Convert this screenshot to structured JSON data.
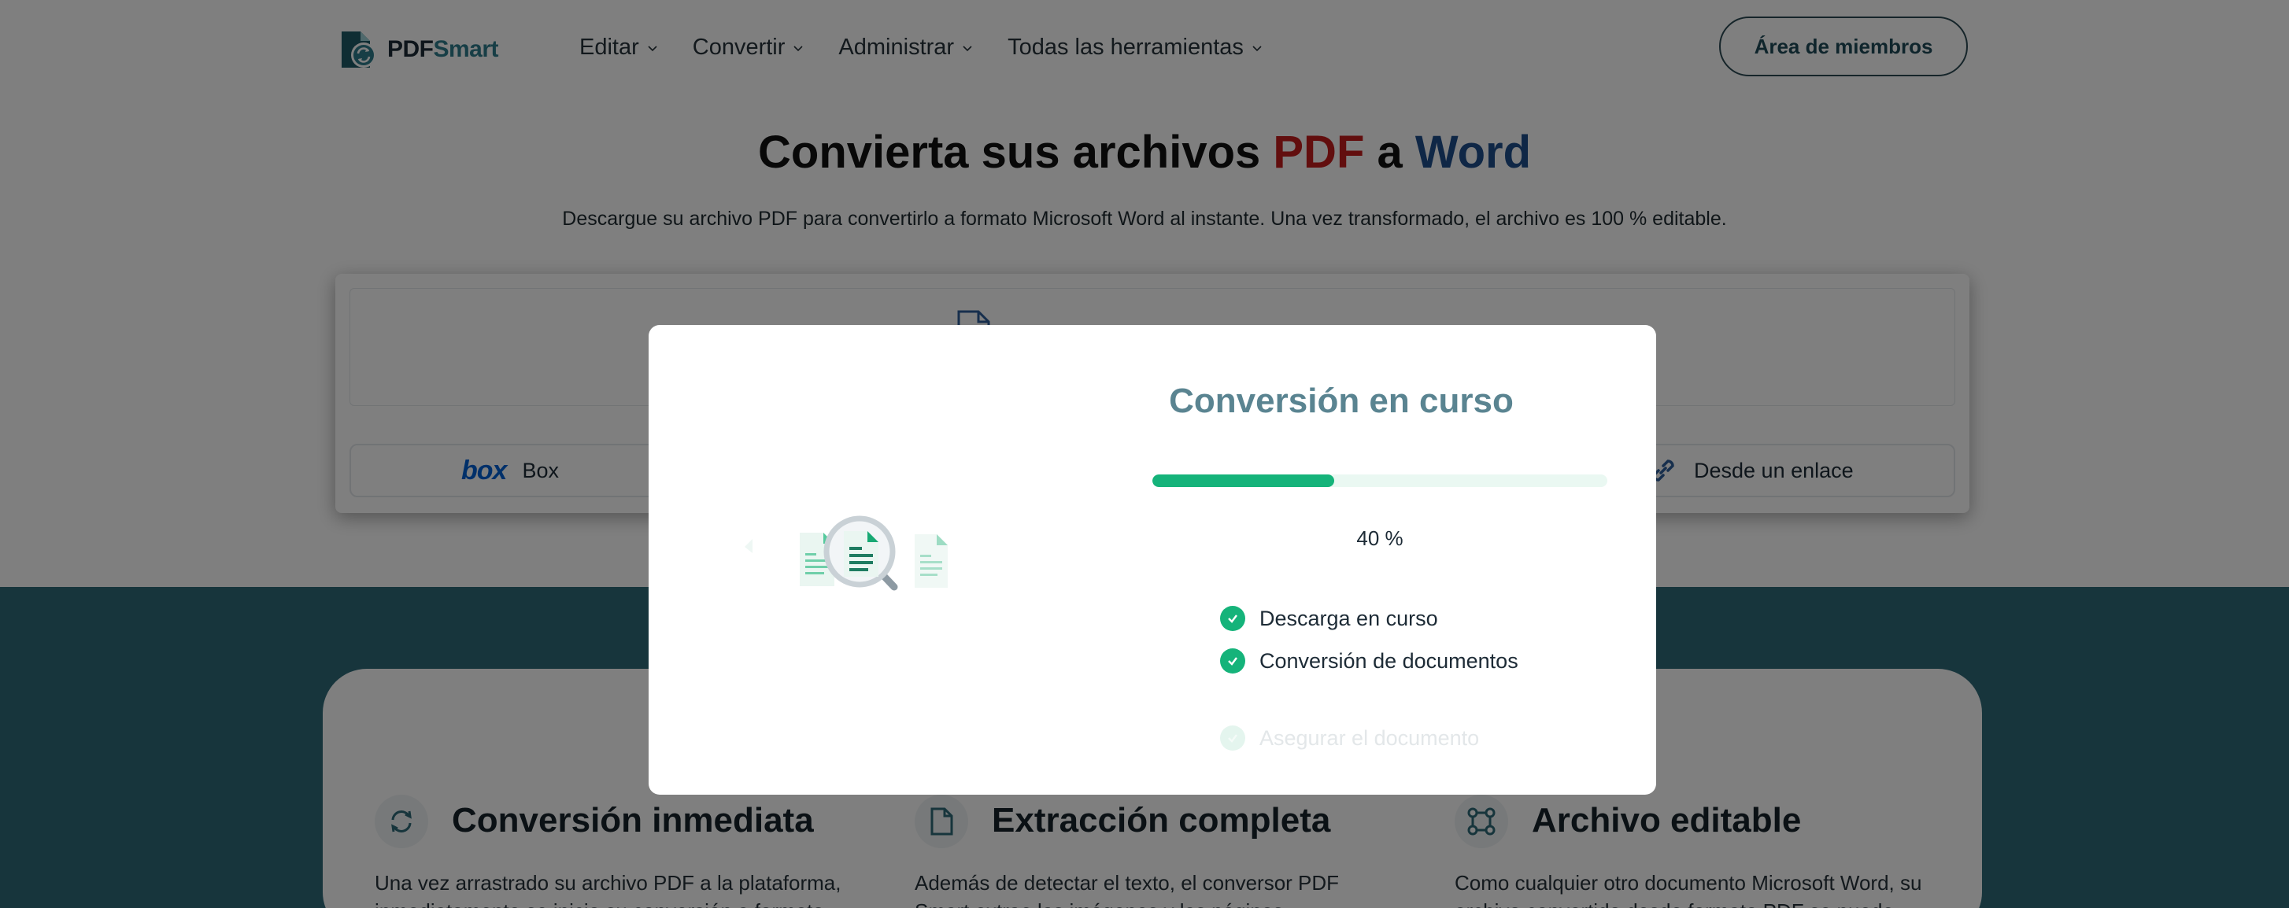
{
  "header": {
    "logo": {
      "prefix": "PDF",
      "suffix": "Smart"
    },
    "nav": [
      {
        "label": "Editar"
      },
      {
        "label": "Convertir"
      },
      {
        "label": "Administrar"
      },
      {
        "label": "Todas las herramientas"
      }
    ],
    "members_button": "Área de miembros"
  },
  "hero": {
    "title_part1": "Convierta sus archivos ",
    "title_pdf": "PDF",
    "title_mid": " a ",
    "title_word": "Word",
    "subtitle": "Descargue su archivo PDF para convertirlo a formato Microsoft Word al instante. Una vez transformado, el archivo es 100 % editable."
  },
  "upload": {
    "box_label": "Box",
    "box_logo": "box",
    "link_label": "Desde un enlace"
  },
  "features": [
    {
      "icon": "refresh-icon",
      "title": "Conversión inmediata",
      "desc": "Una vez arrastrado su archivo PDF a la plataforma, inmediatamente se inicia su conversión a formato"
    },
    {
      "icon": "document-icon",
      "title": "Extracción completa",
      "desc": "Además de detectar el texto, el conversor PDF Smart extrae las imágenes y las páginas"
    },
    {
      "icon": "vector-nodes-icon",
      "title": "Archivo editable",
      "desc": "Como cualquier otro documento Microsoft Word, su archivo convertido desde formato PDF se puede"
    }
  ],
  "modal": {
    "title": "Conversión en curso",
    "progress_fraction": 0.4,
    "percent_text": "40 %",
    "steps": [
      {
        "label": "Descarga en curso",
        "done": true
      },
      {
        "label": "Conversión de documentos",
        "done": true
      },
      {
        "label": "Asegurar el documento",
        "done": false
      }
    ]
  },
  "colors": {
    "accent_green": "#15b37a",
    "brand_teal": "#2e6a79",
    "pdf_red": "#c51c1c",
    "word_blue": "#1f4e8c",
    "modal_title": "#5a8491"
  }
}
